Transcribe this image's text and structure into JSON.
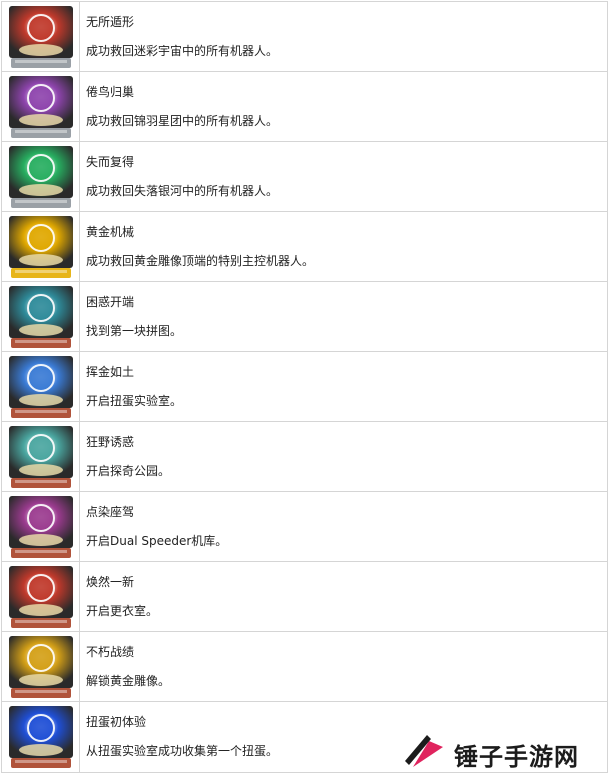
{
  "trophies": [
    {
      "title": "无所遁形",
      "description": "成功救回迷彩宇宙中的所有机器人。",
      "icon": "galaxy-trophy-icon",
      "color": "#c0392b",
      "grade": "silver"
    },
    {
      "title": "倦鸟归巢",
      "description": "成功救回锦羽星团中的所有机器人。",
      "icon": "galaxy-trophy-icon",
      "color": "#8e44ad",
      "grade": "silver"
    },
    {
      "title": "失而复得",
      "description": "成功救回失落银河中的所有机器人。",
      "icon": "galaxy-trophy-icon",
      "color": "#27ae60",
      "grade": "silver"
    },
    {
      "title": "黄金机械",
      "description": "成功救回黄金雕像顶端的特别主控机器人。",
      "icon": "golden-robot-trophy-icon",
      "color": "#e0a800",
      "grade": "gold"
    },
    {
      "title": "困惑开端",
      "description": "找到第一块拼图。",
      "icon": "puzzle-trophy-icon",
      "color": "#2e8b9a",
      "grade": "bronze"
    },
    {
      "title": "挥金如土",
      "description": "开启扭蛋实验室。",
      "icon": "gacha-lab-trophy-icon",
      "color": "#3a7bd5",
      "grade": "bronze"
    },
    {
      "title": "狂野诱惑",
      "description": "开启探奇公园。",
      "icon": "elephant-trophy-icon",
      "color": "#4aa6a0",
      "grade": "bronze"
    },
    {
      "title": "点染座驾",
      "description": "开启Dual Speeder机库。",
      "icon": "hangar-trophy-icon",
      "color": "#9b3b8f",
      "grade": "bronze"
    },
    {
      "title": "焕然一新",
      "description": "开启更衣室。",
      "icon": "changing-room-trophy-icon",
      "color": "#c0392b",
      "grade": "bronze"
    },
    {
      "title": "不朽战绩",
      "description": "解锁黄金雕像。",
      "icon": "golden-statue-trophy-icon",
      "color": "#d4a017",
      "grade": "bronze"
    },
    {
      "title": "扭蛋初体验",
      "description": "从扭蛋实验室成功收集第一个扭蛋。",
      "icon": "playstation-capsule-trophy-icon",
      "color": "#1f4fd6",
      "grade": "bronze"
    }
  ],
  "watermark": {
    "text": "锤子手游网",
    "icon": "hammer-logo-icon",
    "accent": "#e0245e"
  }
}
